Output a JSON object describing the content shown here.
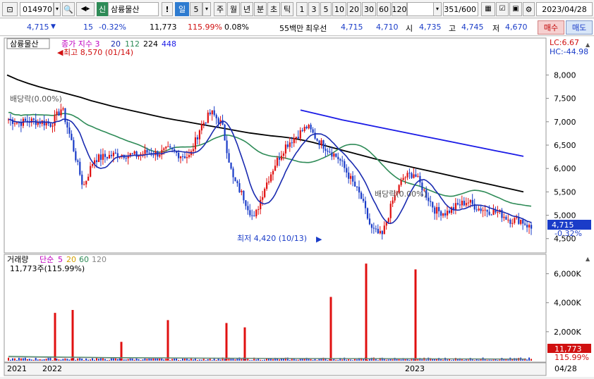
{
  "toolbar": {
    "code": "014970",
    "market_badge": "신",
    "stock_name": "삼륭물산",
    "excl": "!",
    "period_day": "일",
    "period_num": "5",
    "periods": [
      "주",
      "월",
      "년",
      "분",
      "초",
      "틱"
    ],
    "intervals": [
      "1",
      "3",
      "5",
      "10",
      "20",
      "30",
      "60",
      "120"
    ],
    "count_current": "351",
    "count_total": "/600",
    "date": "2023/04/28"
  },
  "infobar": {
    "price": "4,715",
    "change": "15",
    "change_pct": "-0.32%",
    "volume": "11,773",
    "volume_pct": "115.99%",
    "turnover": "0.08%",
    "amount_label": "55백만",
    "best_ask_label": "최우선",
    "best_ask": "4,715",
    "best_bid": "4,710",
    "open_label": "시",
    "open": "4,735",
    "high_label": "고",
    "high": "4,745",
    "low_label": "저",
    "low": "4,670",
    "buy_button": "매수",
    "sell_button": "매도"
  },
  "price_panel": {
    "stock_label": "삼륭물산",
    "indicator_label": "종가 지수 3",
    "ma_periods": [
      "20",
      "112",
      "224",
      "448"
    ],
    "ma_colors": [
      "#1a2bb0",
      "#2e8b57",
      "#000000",
      "#1a1ae6"
    ],
    "high_note": "최고 8,570 (01/14)",
    "low_note": "최저 4,420 (10/13)",
    "dividend_note_1": "배당락(0.00%)",
    "dividend_note_2": "배당락(0.00%)",
    "lc": "LC:6.67",
    "hc": "HC:-44.98",
    "price_tag": "4,715",
    "price_tag_pct": "-0.32%",
    "y_ticks": [
      "8,000",
      "7,500",
      "7,000",
      "6,500",
      "6,000",
      "5,500",
      "5,000",
      "4,500"
    ]
  },
  "volume_panel": {
    "label": "거래량",
    "ma_label": "단순",
    "ma_periods": [
      "5",
      "20",
      "60",
      "120"
    ],
    "ma_colors": [
      "#c000c0",
      "#d4a000",
      "#2e8b57",
      "#888888"
    ],
    "summary": "11,773주(115.99%)",
    "y_ticks": [
      "6,000K",
      "4,000K",
      "2,000K"
    ],
    "volume_tag": "11,773",
    "volume_tag_pct": "115.99%"
  },
  "x_axis": {
    "labels": [
      "2021",
      "2022",
      "2023"
    ],
    "end_label": "04/28"
  },
  "chart_data": {
    "type": "candlestick",
    "y_range": [
      4300,
      8700
    ],
    "volume_range": [
      0,
      7000000
    ],
    "x_range_years": [
      "2021",
      "2023"
    ],
    "close_series": [
      7050,
      6980,
      7020,
      7000,
      6950,
      7300,
      6500,
      5600,
      6200,
      6250,
      6300,
      6300,
      6280,
      6350,
      6320,
      6400,
      6300,
      6250,
      6900,
      7200,
      6950,
      5800,
      5400,
      4900,
      5600,
      6100,
      6500,
      6700,
      6900,
      6600,
      6400,
      6200,
      5800,
      5400,
      4700,
      4550,
      5300,
      5800,
      5900,
      5500,
      5100,
      5050,
      5200,
      5300,
      5150,
      5100,
      5050,
      4900,
      4900,
      4715
    ],
    "ma_224": [
      8000,
      7900,
      7820,
      7750,
      7690,
      7640,
      7580,
      7520,
      7450,
      7390,
      7330,
      7280,
      7230,
      7180,
      7130,
      7080,
      7040,
      7000,
      6960,
      6920,
      6880,
      6840,
      6800,
      6760,
      6730,
      6700,
      6680,
      6650,
      6610,
      6560,
      6500,
      6440,
      6380,
      6320,
      6260,
      6200,
      6150,
      6100,
      6050,
      6000,
      5950,
      5900,
      5850,
      5800,
      5750,
      5700,
      5650,
      5600,
      5550,
      5500
    ],
    "ma_448": [
      7250,
      7180,
      7110,
      7040,
      6980,
      6920,
      6860,
      6800,
      6740,
      6680,
      6620,
      6560,
      6500,
      6440,
      6380,
      6320,
      6260
    ],
    "volume_spikes": [
      {
        "label": "2022-01",
        "value": 3300000
      },
      {
        "label": "2022-02",
        "value": 3500000
      },
      {
        "label": "2022-09",
        "value": 4400000
      },
      {
        "label": "2022-12",
        "value": 6700000
      },
      {
        "label": "2023-01",
        "value": 6300000
      }
    ]
  }
}
